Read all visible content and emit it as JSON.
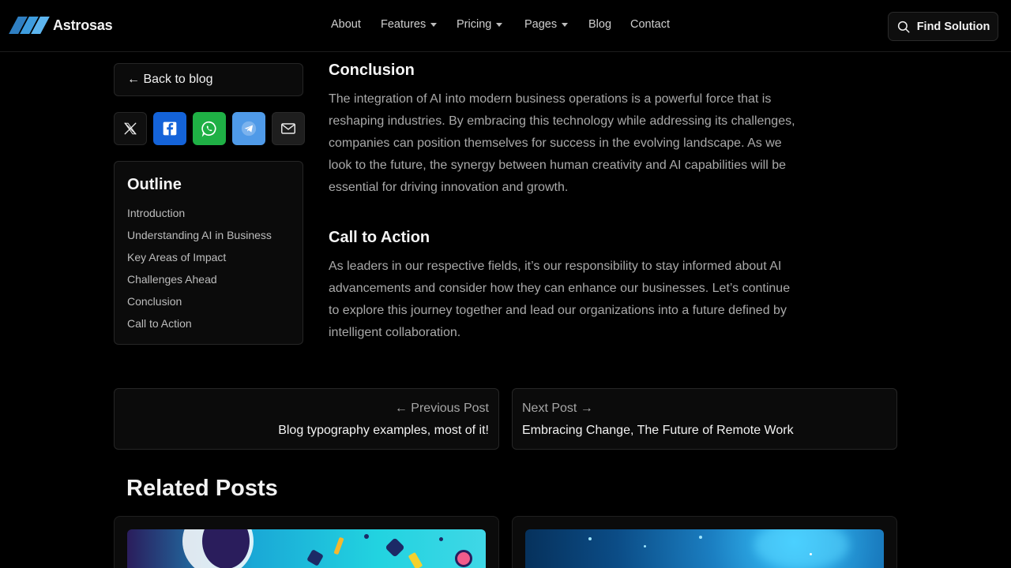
{
  "brand": {
    "name": "Astrosas"
  },
  "nav": {
    "items": [
      {
        "label": "About",
        "dropdown": false
      },
      {
        "label": "Features",
        "dropdown": true
      },
      {
        "label": "Pricing",
        "dropdown": true
      },
      {
        "label": "Pages",
        "dropdown": true
      },
      {
        "label": "Blog",
        "dropdown": false
      },
      {
        "label": "Contact",
        "dropdown": false
      }
    ],
    "cta_label": "Find Solution"
  },
  "sidebar": {
    "back_label": "← Back to blog",
    "share_icons": [
      "x-icon",
      "facebook-icon",
      "whatsapp-icon",
      "telegram-icon",
      "mail-icon"
    ],
    "outline": {
      "title": "Outline",
      "items": [
        "Introduction",
        "Understanding AI in Business",
        "Key Areas of Impact",
        "Challenges Ahead",
        "Conclusion",
        "Call to Action"
      ]
    }
  },
  "article": {
    "sections": [
      {
        "heading": "Conclusion",
        "body": "The integration of AI into modern business operations is a powerful force that is reshaping industries. By embracing this technology while addressing its challenges, companies can position themselves for success in the evolving landscape. As we look to the future, the synergy between human creativity and AI capabilities will be essential for driving innovation and growth."
      },
      {
        "heading": "Call to Action",
        "body": "As leaders in our respective fields, it’s our responsibility to stay informed about AI advancements and consider how they can enhance our businesses. Let’s continue to explore this journey together and lead our organizations into a future defined by intelligent collaboration."
      }
    ]
  },
  "post_nav": {
    "previous": {
      "label": "← Previous Post",
      "title": "Blog typography examples, most of it!"
    },
    "next": {
      "label": "Next Post →",
      "title": "Embracing Change, The Future of Remote Work"
    }
  },
  "related": {
    "title": "Related Posts"
  },
  "colors": {
    "background": "#000000",
    "facebook": "#1463d9",
    "whatsapp": "#1fb045",
    "telegram": "#4f9ae8",
    "logo_blue": "#3b9be0"
  }
}
